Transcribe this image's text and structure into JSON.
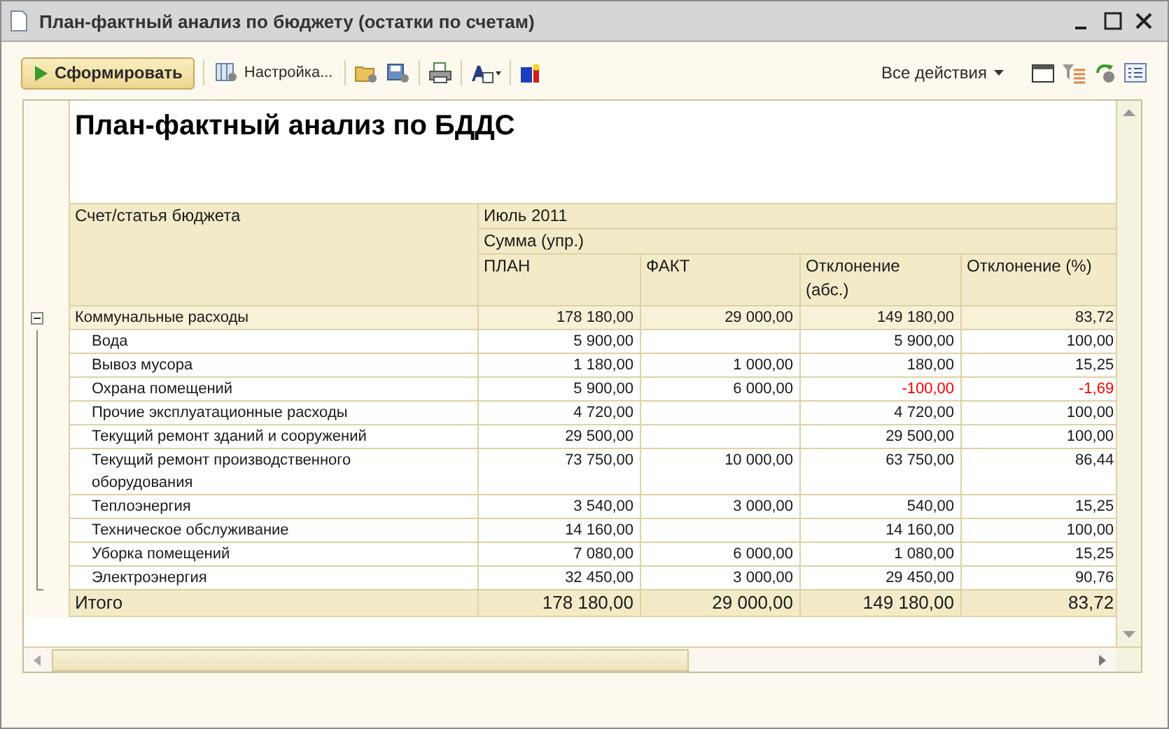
{
  "window": {
    "title": "План-фактный анализ по бюджету (остатки по счетам)"
  },
  "toolbar": {
    "run_button": "Сформировать",
    "settings_button": "Настройка...",
    "all_actions": "Все действия"
  },
  "report": {
    "title": "План-фактный анализ по БДДС",
    "header": {
      "account": "Счет/статья бюджета",
      "period": "Июль 2011",
      "measure": "Сумма (упр.)",
      "columns": [
        "ПЛАН",
        "ФАКТ",
        "Отклонение (абс.)",
        "Отклонение (%)"
      ]
    },
    "rows": [
      {
        "kind": "group",
        "name": "Коммунальные расходы",
        "plan": "178 180,00",
        "fact": "29 000,00",
        "dev_abs": "149 180,00",
        "dev_pct": "83,72",
        "negative": false,
        "expanded": true,
        "children": [
          {
            "kind": "item",
            "name": "Вода",
            "plan": "5 900,00",
            "dev_abs": "5 900,00",
            "dev_pct": "100,00",
            "negative": false
          },
          {
            "kind": "item",
            "name": "Вывоз мусора",
            "plan": "1 180,00",
            "fact": "1 000,00",
            "dev_abs": "180,00",
            "dev_pct": "15,25",
            "negative": false
          },
          {
            "kind": "item",
            "name": "Охрана помещений",
            "plan": "5 900,00",
            "fact": "6 000,00",
            "dev_abs": "-100,00",
            "dev_pct": "-1,69",
            "negative": true
          },
          {
            "kind": "item",
            "name": "Прочие эксплуатационные расходы",
            "plan": "4 720,00",
            "dev_abs": "4 720,00",
            "dev_pct": "100,00",
            "negative": false
          },
          {
            "kind": "item",
            "name": "Текущий ремонт зданий и сооружений",
            "plan": "29 500,00",
            "dev_abs": "29 500,00",
            "dev_pct": "100,00",
            "negative": false
          },
          {
            "kind": "item",
            "name": "Текущий ремонт производственного оборудования",
            "plan": "73 750,00",
            "fact": "10 000,00",
            "dev_abs": "63 750,00",
            "dev_pct": "86,44",
            "negative": false
          },
          {
            "kind": "item",
            "name": "Теплоэнергия",
            "plan": "3 540,00",
            "fact": "3 000,00",
            "dev_abs": "540,00",
            "dev_pct": "15,25",
            "negative": false
          },
          {
            "kind": "item",
            "name": "Техническое обслуживание",
            "plan": "14 160,00",
            "dev_abs": "14 160,00",
            "dev_pct": "100,00",
            "negative": false
          },
          {
            "kind": "item",
            "name": "Уборка помещений",
            "plan": "7 080,00",
            "fact": "6 000,00",
            "dev_abs": "1 080,00",
            "dev_pct": "15,25",
            "negative": false
          },
          {
            "kind": "item",
            "name": "Электроэнергия",
            "plan": "32 450,00",
            "fact": "3 000,00",
            "dev_abs": "29 450,00",
            "dev_pct": "90,76",
            "negative": false
          }
        ]
      },
      {
        "kind": "total",
        "name": "Итого",
        "plan": "178 180,00",
        "fact": "29 000,00",
        "dev_abs": "149 180,00",
        "dev_pct": "83,72",
        "negative": false
      }
    ]
  }
}
